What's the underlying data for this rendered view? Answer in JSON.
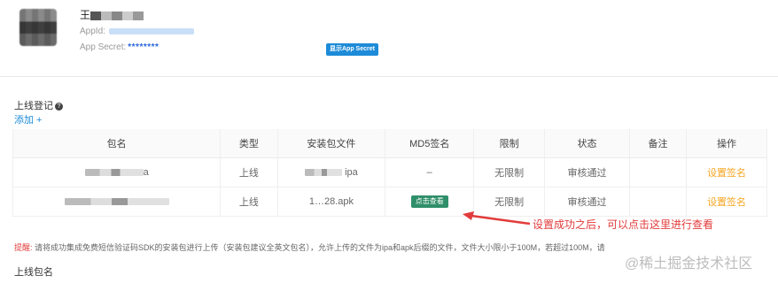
{
  "app": {
    "name_prefix": "王",
    "appid_label": "AppId:",
    "secret_label": "App Secret:",
    "secret_masked": "********",
    "show_secret_button": "显示App Secret"
  },
  "section": {
    "title": "上线登记",
    "add_link": "添加 +"
  },
  "table": {
    "headers": [
      "包名",
      "类型",
      "安装包文件",
      "MD5签名",
      "限制",
      "状态",
      "备注",
      "操作"
    ],
    "rows": [
      {
        "pkg": "a",
        "type": "上线",
        "file": "ipa",
        "md5": "–",
        "limit": "无限制",
        "status": "审核通过",
        "note": "",
        "op": "设置签名"
      },
      {
        "pkg": "",
        "type": "上线",
        "file": "1…28.apk",
        "md5_button": "点击查看",
        "limit": "无限制",
        "status": "审核通过",
        "note": "",
        "op": "设置签名"
      }
    ]
  },
  "annotation": "设置成功之后，可以点击这里进行查看",
  "tip": {
    "label": "提醒:",
    "text": "请将成功集成免费短信验证码SDK的安装包进行上传（安装包建议全英文包名），允许上传的文件为ipa和apk后缀的文件，文件大小限小于100M，若超过100M，请"
  },
  "upload_title": "上线包名",
  "watermark": "@稀土掘金技术社区"
}
